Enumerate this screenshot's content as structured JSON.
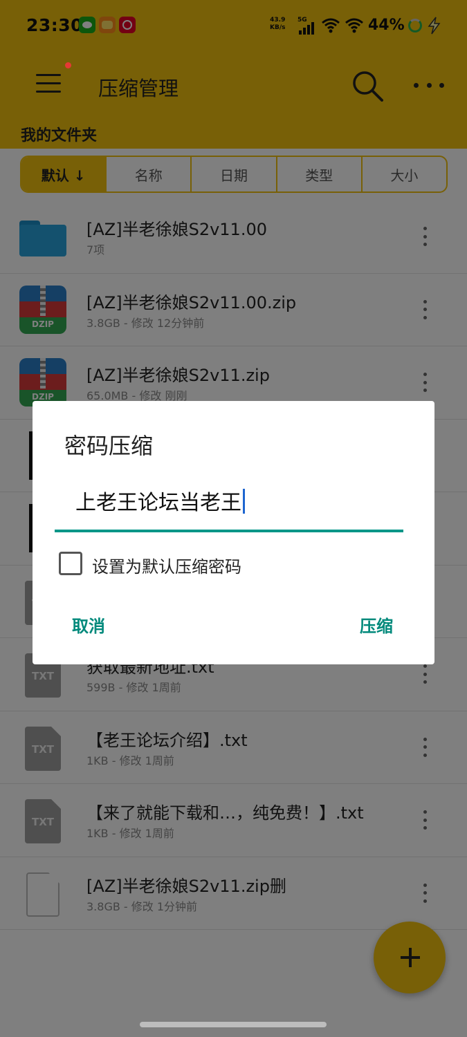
{
  "status_bar": {
    "time": "23:30",
    "net_speed_value": "43.9",
    "net_speed_unit": "KB/s",
    "network_type": "5G",
    "battery_percent": "44%",
    "notification_icons": [
      "wechat-icon",
      "game-app-icon",
      "netease-music-icon"
    ]
  },
  "app_bar": {
    "title": "压缩管理",
    "menu_badge": true,
    "folder_label": "我的文件夹"
  },
  "sort": {
    "tabs": [
      {
        "label": "默认 ↓",
        "active": true
      },
      {
        "label": "名称",
        "active": false
      },
      {
        "label": "日期",
        "active": false
      },
      {
        "label": "类型",
        "active": false
      },
      {
        "label": "大小",
        "active": false
      }
    ]
  },
  "files": [
    {
      "icon": "folder-icon",
      "name": "[AZ]半老徐娘S2v11.00",
      "meta": "7项"
    },
    {
      "icon": "dzip-archive-icon",
      "name": "[AZ]半老徐娘S2v11.00.zip",
      "meta": "3.8GB - 修改 12分钟前"
    },
    {
      "icon": "dzip-archive-icon",
      "name": "[AZ]半老徐娘S2v11.zip",
      "meta": "65.0MB - 修改 刚刚"
    },
    {
      "icon": "dark-file-icon",
      "name": "",
      "meta": ""
    },
    {
      "icon": "dark-file-icon",
      "name": "",
      "meta": ""
    },
    {
      "icon": "txt-file-icon",
      "name": "",
      "meta": ""
    },
    {
      "icon": "txt-file-icon",
      "name": "获取最新地址.txt",
      "meta": "599B - 修改 1周前"
    },
    {
      "icon": "txt-file-icon",
      "name": "【老王论坛介绍】.txt",
      "meta": "1KB - 修改 1周前"
    },
    {
      "icon": "txt-file-icon",
      "name": "【来了就能下载和…，纯免费！】.txt",
      "meta": "1KB - 修改 1周前"
    },
    {
      "icon": "blank-file-icon",
      "name": "[AZ]半老徐娘S2v11.zip删",
      "meta": "3.8GB - 修改 1分钟前"
    }
  ],
  "icon_labels": {
    "dzip": "DZIP",
    "txt": "TXT"
  },
  "dialog": {
    "title": "密码压缩",
    "password_value": "上老王论坛当老王",
    "checkbox_label": "设置为默认压缩密码",
    "checkbox_checked": false,
    "cancel_label": "取消",
    "confirm_label": "压缩"
  },
  "colors": {
    "accent": "#f0c10f",
    "dialog_accent": "#009688",
    "scrim": "rgba(0,0,0,0.5)"
  }
}
